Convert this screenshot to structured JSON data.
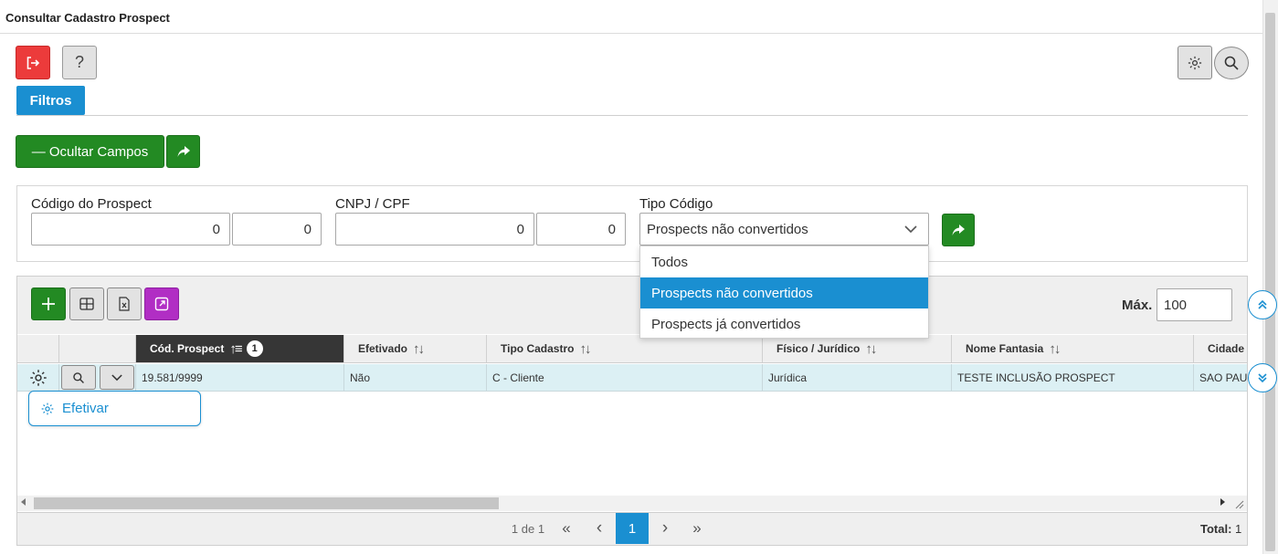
{
  "window": {
    "title": "Consultar Cadastro Prospect"
  },
  "toolbar": {
    "exit_icon": "sign-out-icon",
    "help_label": "?",
    "settings_icon": "gear-icon",
    "search_icon": "search-icon"
  },
  "tabs": {
    "filtros_label": "Filtros"
  },
  "actions": {
    "ocultar_label": "— Ocultar Campos",
    "share_icon": "share-forward-icon"
  },
  "filters": {
    "codigo_label": "Código do Prospect",
    "codigo_from": "0",
    "codigo_to": "0",
    "cnpj_label": "CNPJ / CPF",
    "cnpj_from": "0",
    "cnpj_to": "0",
    "tipo_label": "Tipo Código",
    "tipo_selected": "Prospects não convertidos",
    "tipo_options": [
      "Todos",
      "Prospects não convertidos",
      "Prospects já convertidos"
    ]
  },
  "grid": {
    "max_label": "Máx.",
    "max_value": "100",
    "columns": [
      {
        "label": "Cód. Prospect",
        "sort_badge": "1"
      },
      {
        "label": "Efetivado"
      },
      {
        "label": "Tipo Cadastro"
      },
      {
        "label": "Físico / Jurídico"
      },
      {
        "label": "Nome Fantasia"
      },
      {
        "label": "Cidade"
      }
    ],
    "rows": [
      {
        "codigo": "19.581/9999",
        "efetivado": "Não",
        "tipo": "C - Cliente",
        "fisico": "Jurídica",
        "nome": "TESTE INCLUSÃO PROSPECT",
        "cidade": "SAO PAULO"
      }
    ],
    "row_menu": {
      "efetivar_label": "Efetivar"
    }
  },
  "pager": {
    "page_info": "1 de 1",
    "first": "«",
    "prev": "‹",
    "current": "1",
    "next": "›",
    "last": "»",
    "total_label": "Total:",
    "total_value": "1"
  },
  "colors": {
    "accent": "#1a8fd1",
    "green": "#238a23",
    "red": "#ec3b3b",
    "purple": "#b12ec4",
    "row_selected": "#dcf0f4"
  }
}
